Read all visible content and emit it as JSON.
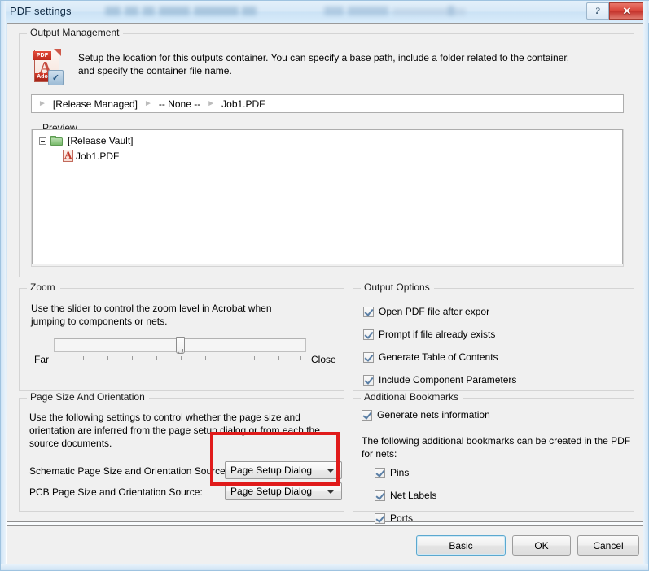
{
  "window": {
    "title": "PDF settings",
    "help_button": "?",
    "close_button": "✕"
  },
  "output_management": {
    "legend": "Output Management",
    "icon": "adobe-pdf-icon",
    "icon_banner": "PDF",
    "icon_brand": "Adobe",
    "description_line1": "Setup the location for this outputs container. You can specify a base path, include a folder related to the container,",
    "description_line2": "and specify the container file name.",
    "path": {
      "segments": [
        "[Release Managed]",
        "-- None --",
        "Job1.PDF"
      ],
      "arrow": "►"
    }
  },
  "preview": {
    "legend": "Preview",
    "tree": {
      "root_label": "[Release Vault]",
      "child_label": "Job1.PDF",
      "expander": "−"
    }
  },
  "zoom": {
    "legend": "Zoom",
    "description_line1": "Use the slider to control the zoom level in Acrobat when",
    "description_line2": "jumping to components or nets.",
    "min_label": "Far",
    "max_label": "Close",
    "slider": {
      "min": 0,
      "max": 10,
      "value": 5,
      "tick_count": 11
    }
  },
  "output_options": {
    "legend": "Output Options",
    "items": [
      {
        "label": "Open PDF file after expor",
        "accel": "O",
        "checked": true
      },
      {
        "label": "Prompt if file already exists",
        "accel": "P",
        "checked": true
      },
      {
        "label": "Generate Table of Contents",
        "accel": "G",
        "checked": true
      },
      {
        "label": "Include Component Parameters",
        "accel": "",
        "checked": true
      }
    ]
  },
  "page_size_and_orientation": {
    "legend": "Page Size And Orientation",
    "description_line1": "Use the following settings to control whether the page size and",
    "description_line2": "orientation are inferred from the page setup dialog or from each the",
    "description_line3": "source documents.",
    "rows": [
      {
        "label": "Schematic Page Size and Orientation Source:",
        "value": "Page Setup Dialog"
      },
      {
        "label": "PCB Page Size and Orientation Source:",
        "value": "Page Setup Dialog"
      }
    ],
    "highlight_color": "#e01b1b"
  },
  "additional_bookmarks": {
    "legend": "Additional Bookmarks",
    "generate_nets": {
      "label": "Generate nets information",
      "checked": true
    },
    "description_line1": "The following additional bookmarks can be created in the PDF",
    "description_line2": "for nets:",
    "items": [
      {
        "label": "Pins",
        "checked": true
      },
      {
        "label": "Net Labels",
        "checked": true
      },
      {
        "label": "Ports",
        "checked": true
      }
    ]
  },
  "footer": {
    "basic_button": "Basic",
    "ok_button": "OK",
    "cancel_button": "Cancel"
  }
}
